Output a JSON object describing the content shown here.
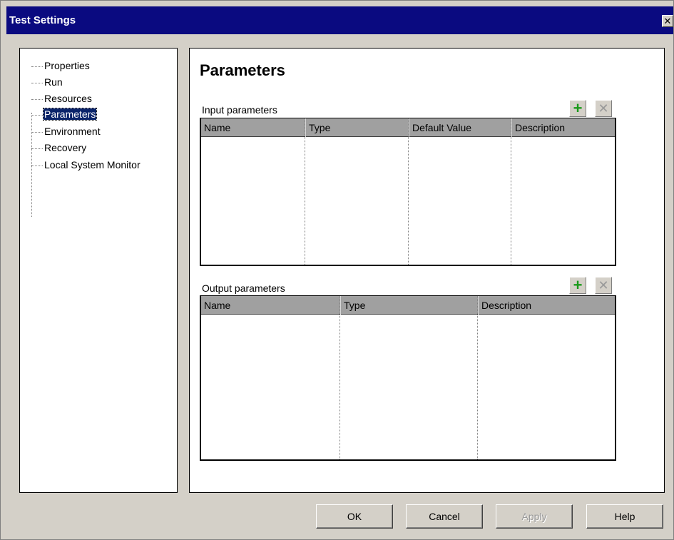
{
  "window": {
    "title": "Test Settings",
    "close_glyph": "✕"
  },
  "sidebar": {
    "items": [
      {
        "label": "Properties",
        "selected": false
      },
      {
        "label": "Run",
        "selected": false
      },
      {
        "label": "Resources",
        "selected": false
      },
      {
        "label": "Parameters",
        "selected": true
      },
      {
        "label": "Environment",
        "selected": false
      },
      {
        "label": "Recovery",
        "selected": false
      },
      {
        "label": "Local System Monitor",
        "selected": false
      }
    ]
  },
  "main": {
    "title": "Parameters",
    "input_section": {
      "label": "Input parameters",
      "columns": [
        "Name",
        "Type",
        "Default Value",
        "Description"
      ],
      "rows": [],
      "add_icon": "plus-icon",
      "delete_icon": "x-icon"
    },
    "output_section": {
      "label": "Output parameters",
      "columns": [
        "Name",
        "Type",
        "Description"
      ],
      "rows": [],
      "add_icon": "plus-icon",
      "delete_icon": "x-icon"
    }
  },
  "footer": {
    "ok_label": "OK",
    "cancel_label": "Cancel",
    "apply_label": "Apply",
    "help_label": "Help",
    "apply_disabled": true
  },
  "icons": {
    "add_glyph": "+",
    "delete_glyph": "✕"
  },
  "colors": {
    "titlebar": "#0a0a80",
    "selection": "#0a246a",
    "add_icon": "#1a9a1a",
    "dialog_bg": "#d4d0c8"
  }
}
